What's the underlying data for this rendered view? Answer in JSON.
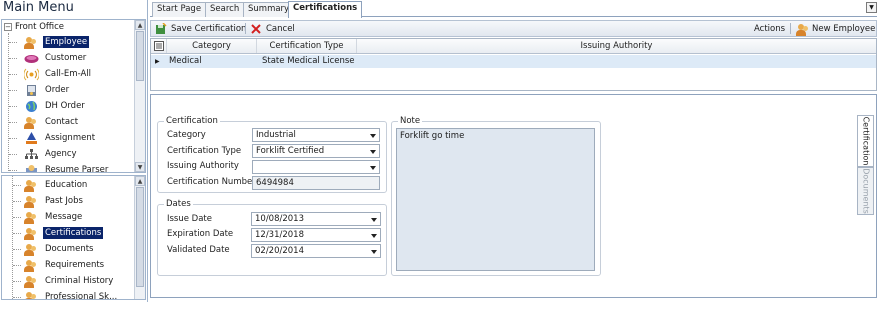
{
  "menu": {
    "title": "Main Menu",
    "top_tree": {
      "root": "Front Office",
      "items": [
        {
          "label": "Employee",
          "icon": "people-icon",
          "selected": true
        },
        {
          "label": "Customer",
          "icon": "customer-icon"
        },
        {
          "label": "Call-Em-All",
          "icon": "broadcast-icon"
        },
        {
          "label": "Order",
          "icon": "order-icon"
        },
        {
          "label": "DH Order",
          "icon": "globe-icon"
        },
        {
          "label": "Contact",
          "icon": "contact-icon"
        },
        {
          "label": "Assignment",
          "icon": "assignment-icon"
        },
        {
          "label": "Agency",
          "icon": "agency-icon"
        },
        {
          "label": "Resume Parser",
          "icon": "resume-icon"
        }
      ]
    },
    "bottom_tree": {
      "items": [
        {
          "label": "Education",
          "icon": "people-icon"
        },
        {
          "label": "Past Jobs",
          "icon": "people-icon"
        },
        {
          "label": "Message",
          "icon": "people-icon"
        },
        {
          "label": "Certifications",
          "icon": "people-icon",
          "selected": true
        },
        {
          "label": "Documents",
          "icon": "people-icon"
        },
        {
          "label": "Requirements",
          "icon": "people-icon"
        },
        {
          "label": "Criminal History",
          "icon": "people-icon"
        },
        {
          "label": "Professional Sk...",
          "icon": "people-icon"
        }
      ]
    }
  },
  "tabs": [
    "Start Page",
    "Search",
    "Summary",
    "Certifications"
  ],
  "toolbar": {
    "save": "Save Certification",
    "cancel": "Cancel",
    "actions": "Actions",
    "new_employee": "New Employee"
  },
  "grid": {
    "headers": [
      "Category",
      "Certification Type",
      "Issuing Authority"
    ],
    "rows": [
      {
        "category": "Medical",
        "type": "State  Medical License",
        "authority": ""
      }
    ]
  },
  "certification": {
    "group_title": "Certification",
    "category_label": "Category",
    "category_value": "Industrial",
    "type_label": "Certification Type",
    "type_value": "Forklift Certified",
    "authority_label": "Issuing Authority",
    "authority_value": "",
    "number_label": "Certification Number",
    "number_value": "6494984"
  },
  "dates": {
    "group_title": "Dates",
    "issue_label": "Issue Date",
    "issue_value": "10/08/2013",
    "expiration_label": "Expiration Date",
    "expiration_value": "12/31/2018",
    "validated_label": "Validated Date",
    "validated_value": "02/20/2014"
  },
  "note": {
    "group_title": "Note",
    "text": "Forklift go time"
  },
  "side_tabs": [
    "Certification",
    "Documents"
  ],
  "colors": {
    "selection": "#0a246a",
    "grid_row": "#ddeaf7",
    "note_bg": "#dfe7f0",
    "cancel_icon": "#d32020"
  }
}
